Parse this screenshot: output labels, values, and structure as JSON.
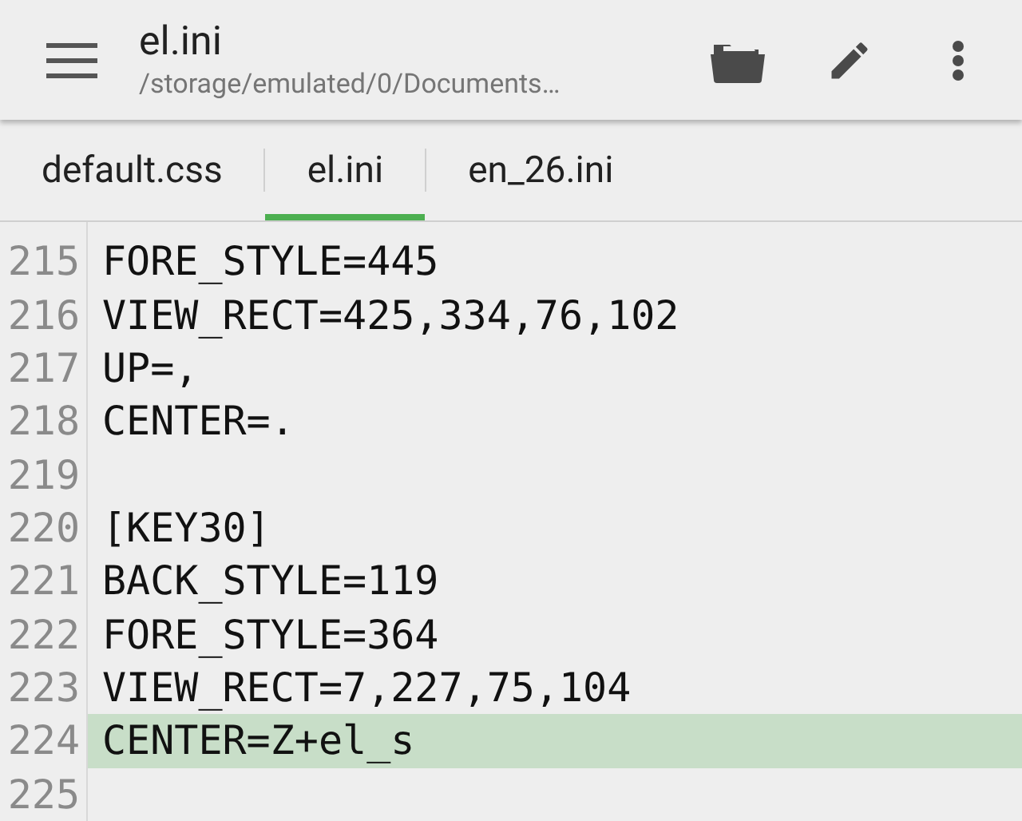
{
  "app_bar": {
    "title": "el.ini",
    "subtitle": "/storage/emulated/0/Documents…"
  },
  "tabs": [
    {
      "label": "default.css",
      "selected": false
    },
    {
      "label": "el.ini",
      "selected": true
    },
    {
      "label": "en_26.ini",
      "selected": false
    }
  ],
  "editor": {
    "lines": [
      {
        "number": "215",
        "text": "FORE_STYLE=445",
        "current": false
      },
      {
        "number": "216",
        "text": "VIEW_RECT=425,334,76,102",
        "current": false
      },
      {
        "number": "217",
        "text": "UP=,",
        "current": false
      },
      {
        "number": "218",
        "text": "CENTER=.",
        "current": false
      },
      {
        "number": "219",
        "current": false
      },
      {
        "number": "220",
        "text": "[KEY30]",
        "current": false
      },
      {
        "number": "221",
        "text": "BACK_STYLE=119",
        "current": false
      },
      {
        "number": "222",
        "text": "FORE_STYLE=364",
        "current": false
      },
      {
        "number": "223",
        "text": "VIEW_RECT=7,227,75,104",
        "current": false
      },
      {
        "number": "224",
        "text": "CENTER=Z+el_s",
        "current": true
      },
      {
        "number": "225",
        "current": false
      }
    ]
  }
}
